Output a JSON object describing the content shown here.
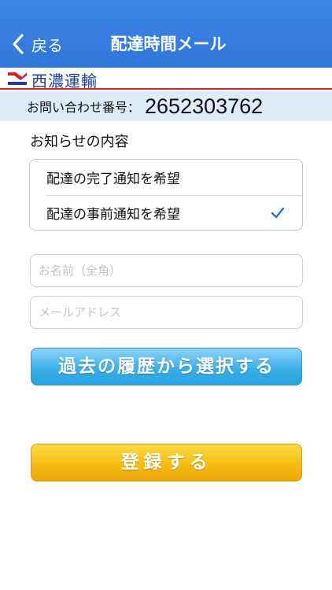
{
  "navbar": {
    "back_label": "戻る",
    "title": "配達時間メール"
  },
  "brand": {
    "logo_icon": "seino-logo-icon",
    "name": "西濃運輸"
  },
  "inquiry": {
    "label": "お問い合わせ番号：",
    "number": "2652303762"
  },
  "notification": {
    "section_label": "お知らせの内容",
    "options": [
      {
        "label": "配達の完了通知を希望",
        "selected": false
      },
      {
        "label": "配達の事前通知を希望",
        "selected": true
      }
    ]
  },
  "form": {
    "name_placeholder": "お名前（全角）",
    "email_placeholder": "メールアドレス"
  },
  "buttons": {
    "history_label": "過去の履歴から選択する",
    "register_label": "登録する"
  },
  "colors": {
    "navbar": "#3a80e2",
    "brand_line": "#d8202c",
    "inquiry_bg": "#ddebfb",
    "check": "#1a73d9",
    "history_button": "#3bb1ea",
    "register_button": "#f6bd12"
  }
}
